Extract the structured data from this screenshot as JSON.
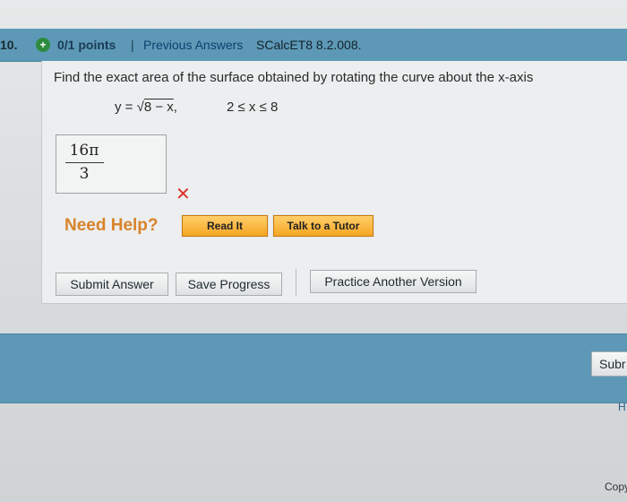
{
  "header": {
    "question_number": "10.",
    "points_icon": "plus-circle-icon",
    "points": "0/1 points",
    "separator": "|",
    "previous_answers": "Previous Answers",
    "question_code": "SCalcET8 8.2.008."
  },
  "question": {
    "prompt": "Find the exact area of the surface obtained by rotating the curve about the x-axis",
    "equation_lhs": "y = √",
    "equation_radicand": "8 − x",
    "equation_sep": ",",
    "interval": "2 ≤ x ≤ 8"
  },
  "answer": {
    "numerator": "16π",
    "denominator": "3",
    "status_icon": "wrong-x-icon",
    "status_glyph": "✕"
  },
  "help": {
    "label": "Need Help?",
    "read_it": "Read It",
    "talk_to_tutor": "Talk to a Tutor"
  },
  "actions": {
    "submit": "Submit Answer",
    "save": "Save Progress",
    "practice": "Practice Another Version"
  },
  "footer": {
    "submit_partial": "Subr",
    "home_partial": "H",
    "copyright_partial": "Copy"
  },
  "colors": {
    "header_bar": "#5d99b6",
    "wrong": "#d9342b",
    "need_help": "#d9832a",
    "help_button": "#f5a623"
  }
}
